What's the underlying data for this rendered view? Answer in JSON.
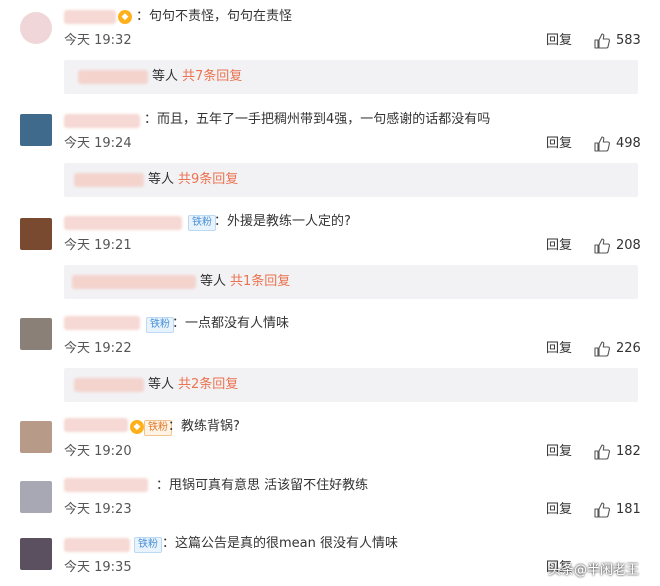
{
  "comments": [
    {
      "text": "：句句不责怪，句句在责怪",
      "time": "今天 19:32",
      "reply_label": "回复",
      "likes": "583",
      "replies": {
        "suffix": "等人",
        "more": "共7条回复"
      }
    },
    {
      "text": "：而且，五年了一手把稠州带到4强，一句感谢的话都没有吗",
      "time": "今天 19:24",
      "reply_label": "回复",
      "likes": "498",
      "replies": {
        "suffix": "等人",
        "more": "共9条回复"
      }
    },
    {
      "badge": "铁粉",
      "text": "：外援是教练一人定的?",
      "time": "今天 19:21",
      "reply_label": "回复",
      "likes": "208",
      "replies": {
        "suffix": "等人",
        "more": "共1条回复"
      }
    },
    {
      "badge": "铁粉",
      "text": "：一点都没有人情味",
      "time": "今天 19:22",
      "reply_label": "回复",
      "likes": "226",
      "replies": {
        "suffix": "等人",
        "more": "共2条回复"
      }
    },
    {
      "badge": "铁粉",
      "text": "：教练背锅?",
      "time": "今天 19:20",
      "reply_label": "回复",
      "likes": "182"
    },
    {
      "text": "：甩锅可真有意思 活该留不住好教练",
      "time": "今天 19:23",
      "reply_label": "回复",
      "likes": "181"
    },
    {
      "badge": "铁粉",
      "text": "：这篇公告是真的很mean 很没有人情味",
      "time": "今天 19:35",
      "reply_label": "回复",
      "likes": ""
    }
  ],
  "watermark": "头条@半闲老王",
  "colors": {
    "link": "#eb7350",
    "badge_blue": "#4a90d4",
    "reply_box_bg": "#f2f2f5"
  },
  "icons": {
    "like": "thumbs-up-icon",
    "vip": "vip-crown-icon"
  }
}
